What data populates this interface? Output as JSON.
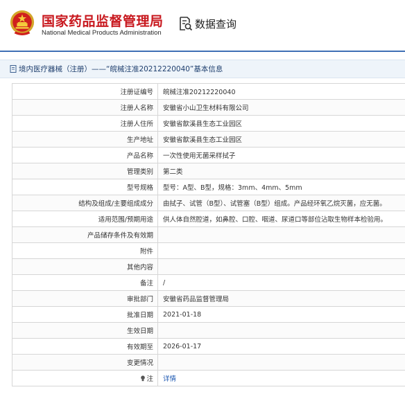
{
  "header": {
    "org_name_cn": "国家药品监督管理局",
    "org_name_en": "National Medical Products Administration",
    "query_label": "数据查询",
    "emblem_icon": "national-emblem-icon",
    "query_icon": "search-document-icon"
  },
  "section": {
    "title": "境内医疗器械（注册）——“皖械注准20212220040”基本信息",
    "icon": "document-icon"
  },
  "details": {
    "rows": [
      {
        "label": "注册证编号",
        "value": "皖械注准20212220040"
      },
      {
        "label": "注册人名称",
        "value": "安徽省小山卫生材料有限公司"
      },
      {
        "label": "注册人住所",
        "value": "安徽省歙溪县生态工业园区"
      },
      {
        "label": "生产地址",
        "value": "安徽省歙溪县生态工业园区"
      },
      {
        "label": "产品名称",
        "value": "一次性使用无菌采样拭子"
      },
      {
        "label": "管理类别",
        "value": "第二类"
      },
      {
        "label": "型号规格",
        "value": "型号：A型、B型，规格：3mm、4mm、5mm"
      },
      {
        "label": "结构及组成/主要组成成分",
        "value": "由拭子、试管（B型）、试管塞（B型）组成。产品经环氧乙烷灭菌，应无菌。"
      },
      {
        "label": "适用范围/预期用途",
        "value": "供人体自然腔道，如鼻腔、口腔、咽道、尿道口等部位沾取生物样本检验用。"
      },
      {
        "label": "产品储存条件及有效期",
        "value": ""
      },
      {
        "label": "附件",
        "value": ""
      },
      {
        "label": "其他内容",
        "value": ""
      },
      {
        "label": "备注",
        "value": "/"
      },
      {
        "label": "审批部门",
        "value": "安徽省药品监督管理局"
      },
      {
        "label": "批准日期",
        "value": "2021-01-18"
      },
      {
        "label": "生效日期",
        "value": ""
      },
      {
        "label": "有效期至",
        "value": "2026-01-17"
      },
      {
        "label": "变更情况",
        "value": ""
      }
    ],
    "note_label": "注",
    "note_icon": "lightbulb-icon",
    "note_link": "详情"
  },
  "colors": {
    "brand_red": "#c8181e",
    "rule_blue": "#3e6fb5",
    "link_blue": "#1a56b0"
  }
}
